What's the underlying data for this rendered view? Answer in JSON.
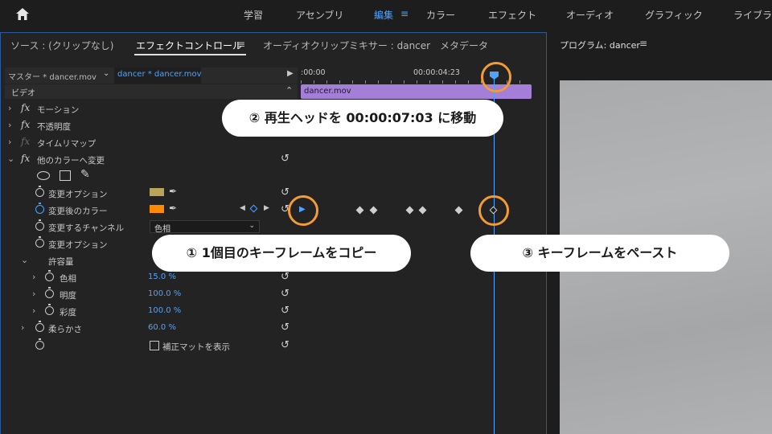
{
  "topnav": {
    "items": [
      "学習",
      "アセンブリ",
      "編集",
      "カラー",
      "エフェクト",
      "オーディオ",
      "グラフィック",
      "ライブラリ"
    ],
    "active": "編集",
    "menu_glyph": "≡"
  },
  "effect_controls": {
    "tabs": [
      "ソース : (クリップなし)",
      "エフェクトコントロール",
      "オーディオクリップミキサー : dancer",
      "メタデータ"
    ],
    "tab_menu_glyph": "≡",
    "clip_bar": {
      "master": "マスター * dancer.mov",
      "current": "dancer * dancer.mov"
    },
    "section_label": "ビデオ",
    "effects": {
      "motion": "モーション",
      "opacity": "不透明度",
      "time_remap": "タイムリマップ",
      "change_to_color": "他のカラーへ変更"
    },
    "properties": {
      "change_option_1": "変更オプション",
      "color_after": "変更後のカラー",
      "channel": "変更するチャンネル",
      "channel_value": "色相",
      "change_option_2": "変更オプション",
      "tolerance": "許容量",
      "hue": "色相",
      "hue_value": "15.0 %",
      "lightness": "明度",
      "lightness_value": "100.0 %",
      "saturation": "彩度",
      "saturation_value": "100.0 %",
      "softness": "柔らかさ",
      "softness_value": "60.0 %",
      "show_matte": "補正マットを表示"
    },
    "swatch_colors": {
      "change_option": "#b8a45a",
      "color_after": "#ff8a00"
    }
  },
  "timeline": {
    "timecode_start": ":00:00",
    "timecode_mid": "00:00:04:23",
    "clip_name": "dancer.mov"
  },
  "program_monitor": {
    "title": "プログラム: dancer",
    "menu_glyph": "≡"
  },
  "callouts": {
    "step1": "① 1個目のキーフレームをコピー",
    "step2": "② 再生ヘッドを 00:00:07:03 に移動",
    "step3": "③ キーフレームをペースト"
  },
  "colors": {
    "accent": "#4fa3ff",
    "highlight_ring": "#f39c33",
    "clip": "#a37fd8"
  }
}
